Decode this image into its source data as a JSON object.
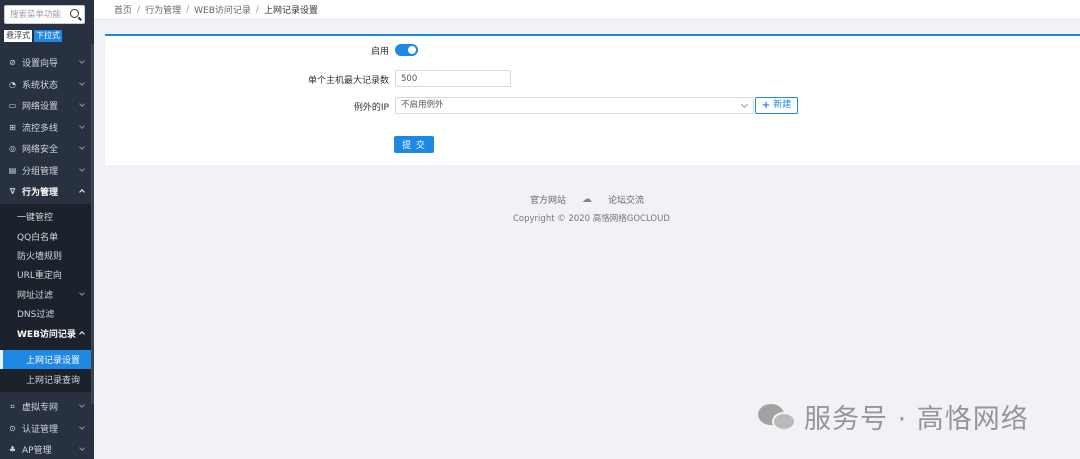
{
  "sidebar": {
    "search_placeholder": "搜索菜单功能",
    "modes": [
      "悬浮式",
      "下拉式"
    ],
    "menu": [
      {
        "label": "设置向导",
        "icon": "⊘"
      },
      {
        "label": "系统状态",
        "icon": "◔"
      },
      {
        "label": "网络设置",
        "icon": "▭"
      },
      {
        "label": "流控多线",
        "icon": "⊞"
      },
      {
        "label": "网络安全",
        "icon": "◎"
      },
      {
        "label": "分组管理",
        "icon": "▤"
      },
      {
        "label": "行为管理",
        "icon": "∇"
      }
    ],
    "behavior_sub": [
      {
        "label": "一键管控"
      },
      {
        "label": "QQ白名单"
      },
      {
        "label": "防火墙规则"
      },
      {
        "label": "URL重定向"
      },
      {
        "label": "网址过滤"
      },
      {
        "label": "DNS过滤"
      },
      {
        "label": "WEB访问记录"
      }
    ],
    "web_sub": [
      {
        "label": "上网记录设置"
      },
      {
        "label": "上网记录查询"
      }
    ],
    "bottom_menu": [
      {
        "label": "虚拟专网",
        "icon": "⌗"
      },
      {
        "label": "认证管理",
        "icon": "⊙"
      },
      {
        "label": "AP管理",
        "icon": "♣"
      }
    ]
  },
  "breadcrumb": [
    "首页",
    "行为管理",
    "WEB访问记录",
    "上网记录设置"
  ],
  "form": {
    "enable_label": "启用",
    "enabled": true,
    "max_records_label": "单个主机最大记录数",
    "max_records_value": "500",
    "exception_ip_label": "例外的IP",
    "exception_ip_value": "不启用例外",
    "new_button": "新建",
    "submit_button": "提 交"
  },
  "footer": {
    "links": [
      "官方网站",
      "论坛交流"
    ],
    "copyright": "Copyright © 2020 高恪网络GOCLOUD"
  },
  "watermark": {
    "text": "服务号 · 高恪网络"
  },
  "colors": {
    "accent": "#1e88e5",
    "sidebar_bg": "#27313f",
    "submenu_bg": "#1b222c"
  }
}
